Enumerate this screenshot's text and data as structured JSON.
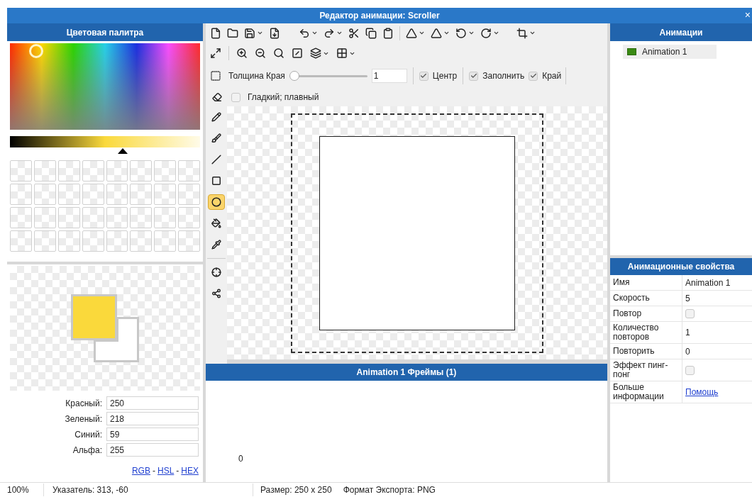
{
  "window": {
    "title": "Редактор анимации: Scroller",
    "close": "×"
  },
  "palette": {
    "header": "Цветовая палитра",
    "gradient": {
      "level": 0.6
    },
    "colors": [
      {
        "color": "#fad93b"
      },
      {
        "color": "#ffffff"
      }
    ],
    "fields": [
      {
        "label": "Красный:",
        "value": "250"
      },
      {
        "label": "Зеленый:",
        "value": "218"
      },
      {
        "label": "Синий:",
        "value": "59"
      },
      {
        "label": "Альфа:",
        "value": "255"
      }
    ],
    "links": [
      "RGB",
      "HSL",
      "HEX"
    ],
    "link_separator": "-"
  },
  "toolbar": {
    "edge_label": "Толщина Края",
    "edge": {
      "level": 0
    },
    "edge_value": "1",
    "checks": [
      {
        "label": "Центр",
        "checked": true
      },
      {
        "label": "Заполнить",
        "checked": true
      },
      {
        "label": "Край",
        "checked": true
      }
    ],
    "smooth": {
      "label": "Гладкий; плавный",
      "checked": false
    }
  },
  "tools": [
    {
      "kind": "eraser",
      "selected": false
    },
    {
      "kind": "pencil",
      "selected": false
    },
    {
      "kind": "brush",
      "selected": false
    },
    {
      "kind": "line",
      "selected": false
    },
    {
      "kind": "rectangle",
      "selected": false
    },
    {
      "kind": "ellipse",
      "selected": true
    },
    {
      "kind": "fill",
      "selected": false
    },
    {
      "kind": "picker",
      "selected": false
    },
    {
      "kind": "move",
      "selected": false
    },
    {
      "kind": "nodes",
      "selected": false
    }
  ],
  "frames": {
    "header": "Animation 1 Фреймы (1)",
    "frame_label": "0"
  },
  "animations": {
    "header": "Анимации",
    "items": [
      {
        "name": "Animation 1"
      }
    ]
  },
  "properties": {
    "header": "Анимационные свойства",
    "rows": [
      {
        "label": "Имя",
        "kind": "text",
        "value": "Animation 1"
      },
      {
        "label": "Скорость",
        "kind": "text",
        "value": "5"
      },
      {
        "label": "Повтор",
        "kind": "checkbox",
        "checked": false
      },
      {
        "label": "Количество повторов",
        "kind": "text",
        "value": "1"
      },
      {
        "label": "Повторить",
        "kind": "text",
        "value": "0"
      },
      {
        "label": "Эффект пинг-понг",
        "kind": "checkbox",
        "checked": false
      },
      {
        "label": "Больше информации",
        "kind": "link",
        "value": "Помощь"
      }
    ]
  },
  "status_bar": {
    "zoom": "100%",
    "pointer": "Указатель: 313, -60",
    "size": "Размер: 250 x 250",
    "format": "Формат Экспорта: PNG"
  }
}
